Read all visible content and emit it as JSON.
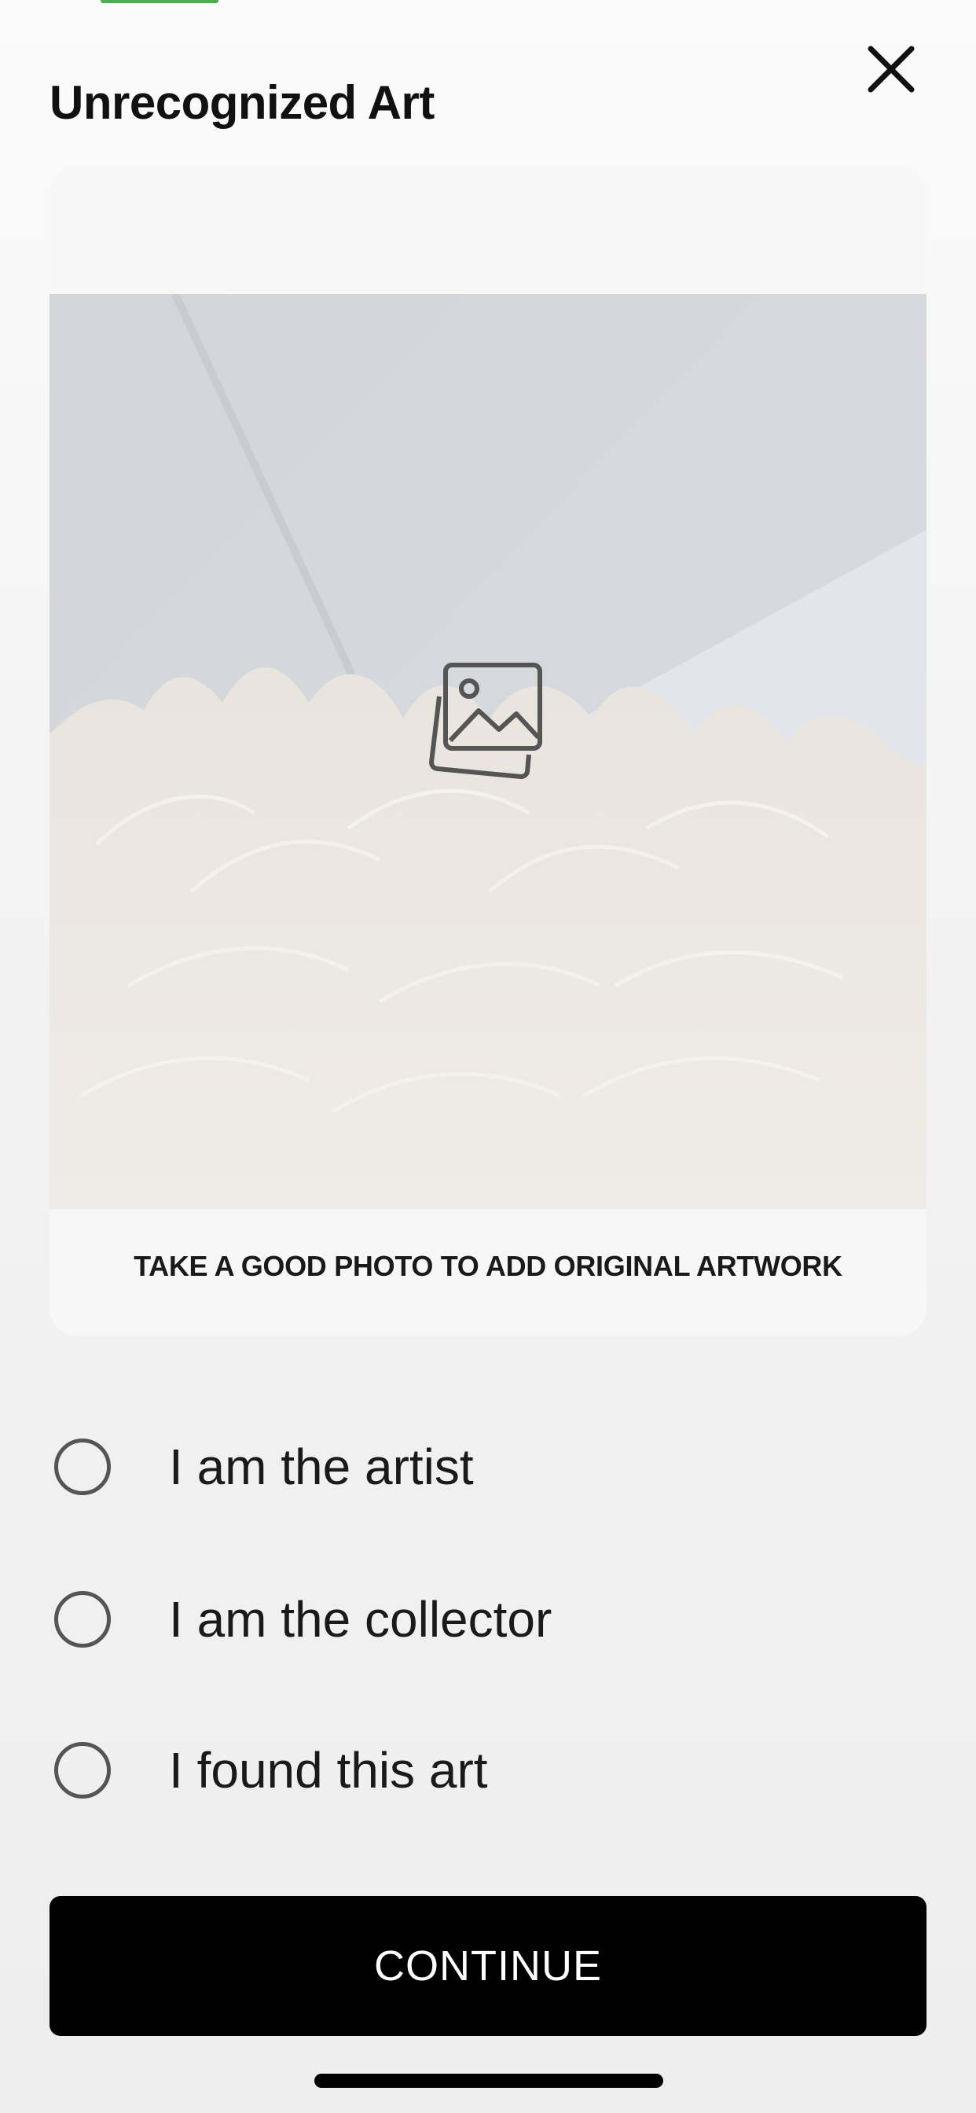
{
  "header": {
    "title": "Unrecognized Art",
    "close_icon": "close-icon"
  },
  "photo_card": {
    "placeholder_icon": "image-gallery-icon",
    "caption": "TAKE A GOOD PHOTO TO ADD ORIGINAL ARTWORK"
  },
  "options": [
    {
      "label": "I am the artist",
      "selected": false
    },
    {
      "label": "I am the collector",
      "selected": false
    },
    {
      "label": "I found this art",
      "selected": false
    }
  ],
  "continue": {
    "label": "CONTINUE"
  },
  "colors": {
    "button_bg": "#000000",
    "button_text": "#ffffff",
    "accent": "#4caf50"
  }
}
